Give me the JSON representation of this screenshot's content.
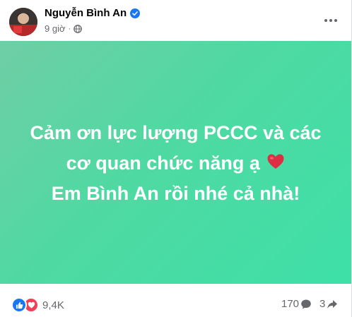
{
  "post": {
    "author_name": "Nguyễn Bình An",
    "time": "9 giờ",
    "separator": "·",
    "message_lines": [
      "Cảm ơn lực lượng PCCC và các",
      "cơ quan chức năng ạ",
      "Em Bình An rồi nhé cả nhà!"
    ],
    "background_colors": [
      "#6fcea5",
      "#3ee0a8"
    ],
    "reaction_icons": [
      "like-icon",
      "love-icon"
    ],
    "reaction_count": "9,4K",
    "comment_count": "170",
    "share_count": "3",
    "emoji": "red-heart-icon"
  }
}
